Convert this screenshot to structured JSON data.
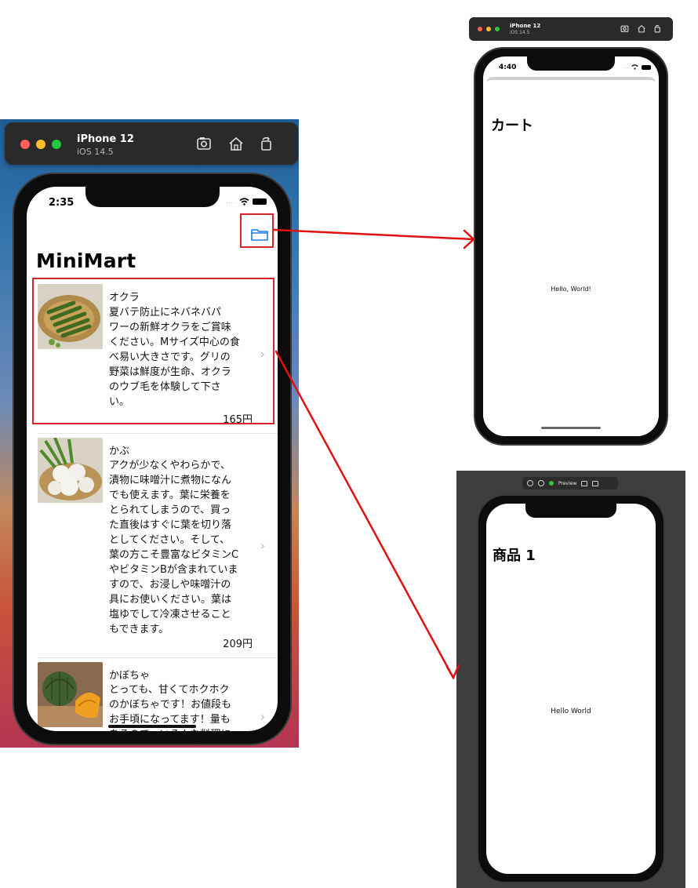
{
  "main_simulator": {
    "device_name": "iPhone 12",
    "os_version": "iOS 14.5",
    "toolbar_icons": [
      "screenshot-icon",
      "home-icon",
      "rotate-icon"
    ],
    "status_time": "2:35",
    "nav_title": "MiniMart",
    "nav_button_icon": "folder-icon",
    "products": [
      {
        "name": "オクラ",
        "description": "夏バテ防止にネバネバパ\nワーの新鮮オクラをご賞味\nください。Mサイズ中心の食\nべ易い大きさです。グリの\n野菜は鮮度が生命、オクラ\nのウブ毛を体験して下さ\nい。",
        "price": "165円"
      },
      {
        "name": "かぶ",
        "description": "アクが少なくやわらかで、\n漬物に味噌汁に煮物になん\nでも使えます。葉に栄養を\nとられてしまうので、買っ\nた直後はすぐに葉を切り落\nとしてください。そして、\n葉の方こそ豊富なビタミンC\nやビタミンBが含まれていま\nすので、お浸しや味噌汁の\n具にお使いください。葉は\n塩ゆでして冷凍させること\nもできます。",
        "price": "209円"
      },
      {
        "name": "かぼちゃ",
        "description": "とっても、甘くてホクホク\nのかぼちゃです！お値段も\nお手頃になってます！量も\nあるので、いろんな料理に",
        "price": ""
      }
    ],
    "highlight_color": "#d7262b"
  },
  "cart_simulator": {
    "device_name": "iPhone 12",
    "os_version": "iOS 14.5",
    "status_time": "4:40",
    "title": "カート",
    "body_text": "Hello, World!"
  },
  "detail_preview": {
    "toolbar_label": "Preview",
    "title": "商品 1",
    "body_text": "Hello World"
  }
}
